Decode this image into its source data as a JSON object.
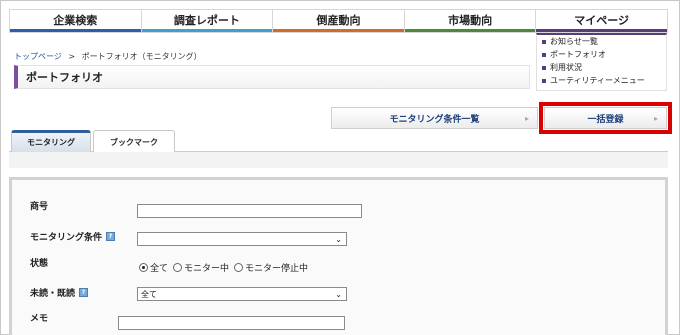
{
  "nav": [
    {
      "label": "企業検索",
      "color": "#2b5fae"
    },
    {
      "label": "調査レポート",
      "color": "#3ca0d0"
    },
    {
      "label": "倒産動向",
      "color": "#d36a2a"
    },
    {
      "label": "市場動向",
      "color": "#4a8a3a"
    },
    {
      "label": "マイページ",
      "color": "#5a3a78"
    }
  ],
  "mypage_menu": [
    "お知らせ一覧",
    "ポートフォリオ",
    "利用状況",
    "ユーティリティーメニュー"
  ],
  "breadcrumb": {
    "home": "トップページ",
    "separator": ">",
    "current": "ポートフォリオ（モニタリング）"
  },
  "page_title": "ポートフォリオ",
  "buttons": {
    "monitoring_list": "モニタリング条件一覧",
    "bulk_register": "一括登録"
  },
  "tabs": [
    "モニタリング",
    "ブックマーク"
  ],
  "form": {
    "company_name_label": "商号",
    "monitoring_condition_label": "モニタリング条件",
    "status_label": "状態",
    "status_options": [
      "全て",
      "モニター中",
      "モニター停止中"
    ],
    "read_label": "未読・既読",
    "read_value": "全て",
    "memo_label": "メモ"
  },
  "colors": {
    "highlight": "#d90000",
    "accent": "#7a4fa0"
  }
}
